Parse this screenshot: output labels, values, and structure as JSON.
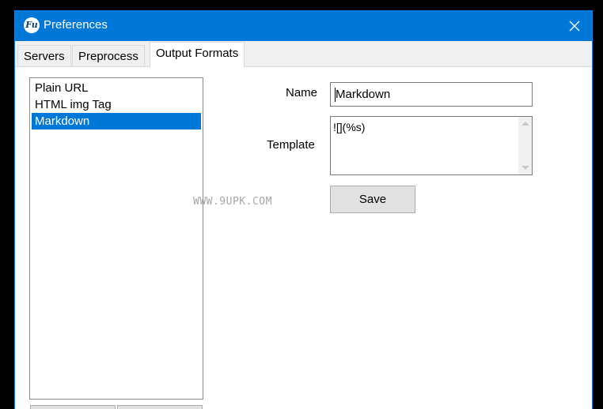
{
  "window": {
    "title": "Preferences",
    "app_icon_text": "Fu",
    "close_glyph": "✕"
  },
  "tabs": [
    {
      "label": "Servers"
    },
    {
      "label": "Preprocess"
    },
    {
      "label": "Output Formats",
      "active": true
    }
  ],
  "formats_list": {
    "items": [
      "Plain URL",
      "HTML img Tag",
      "Markdown"
    ],
    "selected": "Markdown"
  },
  "form": {
    "name_label": "Name",
    "name_value": "Markdown",
    "template_label": "Template",
    "template_value": "![](%s)",
    "save_label": "Save"
  },
  "watermark": "WWW.9UPK.COM",
  "colors": {
    "titlebar": "#0078d7",
    "selection": "#0078d7"
  },
  "icons": {
    "app": "app-logo-icon",
    "close": "close-icon",
    "scroll_up": "chevron-up-icon",
    "scroll_down": "chevron-down-icon"
  }
}
